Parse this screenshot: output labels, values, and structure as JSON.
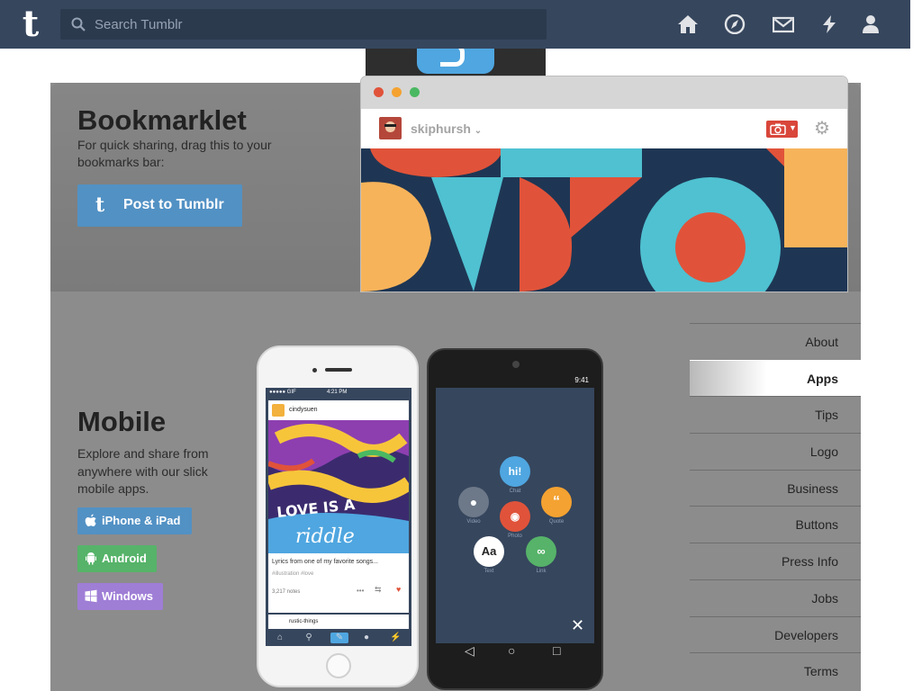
{
  "header": {
    "logo": "t",
    "search_placeholder": "Search Tumblr",
    "nav_icons": [
      "home-icon",
      "explore-icon",
      "mail-icon",
      "activity-icon",
      "account-icon"
    ],
    "bg_color": "#36465d"
  },
  "bookmarklet": {
    "title": "Bookmarklet",
    "description": "For quick sharing, drag this to your bookmarks bar:",
    "button_label": "Post to Tumblr",
    "button_icon": "t",
    "button_color": "#5291c4"
  },
  "browser_mockup": {
    "username": "skiphursh",
    "dot_colors": [
      "#e0533a",
      "#f4a231",
      "#4ab862"
    ]
  },
  "mobile": {
    "title": "Mobile",
    "description": "Explore and share from anywhere with our slick mobile apps.",
    "buttons": [
      {
        "label": "iPhone & iPad",
        "icon": "apple-icon",
        "color": "#5291c4"
      },
      {
        "label": "Android",
        "icon": "android-icon",
        "color": "#56b369"
      },
      {
        "label": "Windows",
        "icon": "windows-icon",
        "color": "#9f7ed6"
      }
    ]
  },
  "iphone_screen": {
    "status_carrier": "●●●●● GIF",
    "status_time": "4:21 PM",
    "post_user": "cindysuen",
    "art_text": "LOVE IS A riddle",
    "caption": "Lyrics from one of my favorite songs...",
    "tags": "#illustration  #love",
    "notes": "3,217 notes",
    "next_user": "rustic-things"
  },
  "android_screen": {
    "status_time": "9:41",
    "bubbles": [
      {
        "label": "Chat",
        "text": "hi!"
      },
      {
        "label": "Video",
        "text": ""
      },
      {
        "label": "Quote",
        "text": "66"
      },
      {
        "label": "Photo",
        "text": ""
      },
      {
        "label": "Text",
        "text": "Aa"
      },
      {
        "label": "Link",
        "text": ""
      }
    ]
  },
  "sidebar": {
    "items": [
      "About",
      "Apps",
      "Tips",
      "Logo",
      "Business",
      "Buttons",
      "Press Info",
      "Jobs",
      "Developers",
      "Terms"
    ],
    "active": "Apps"
  }
}
